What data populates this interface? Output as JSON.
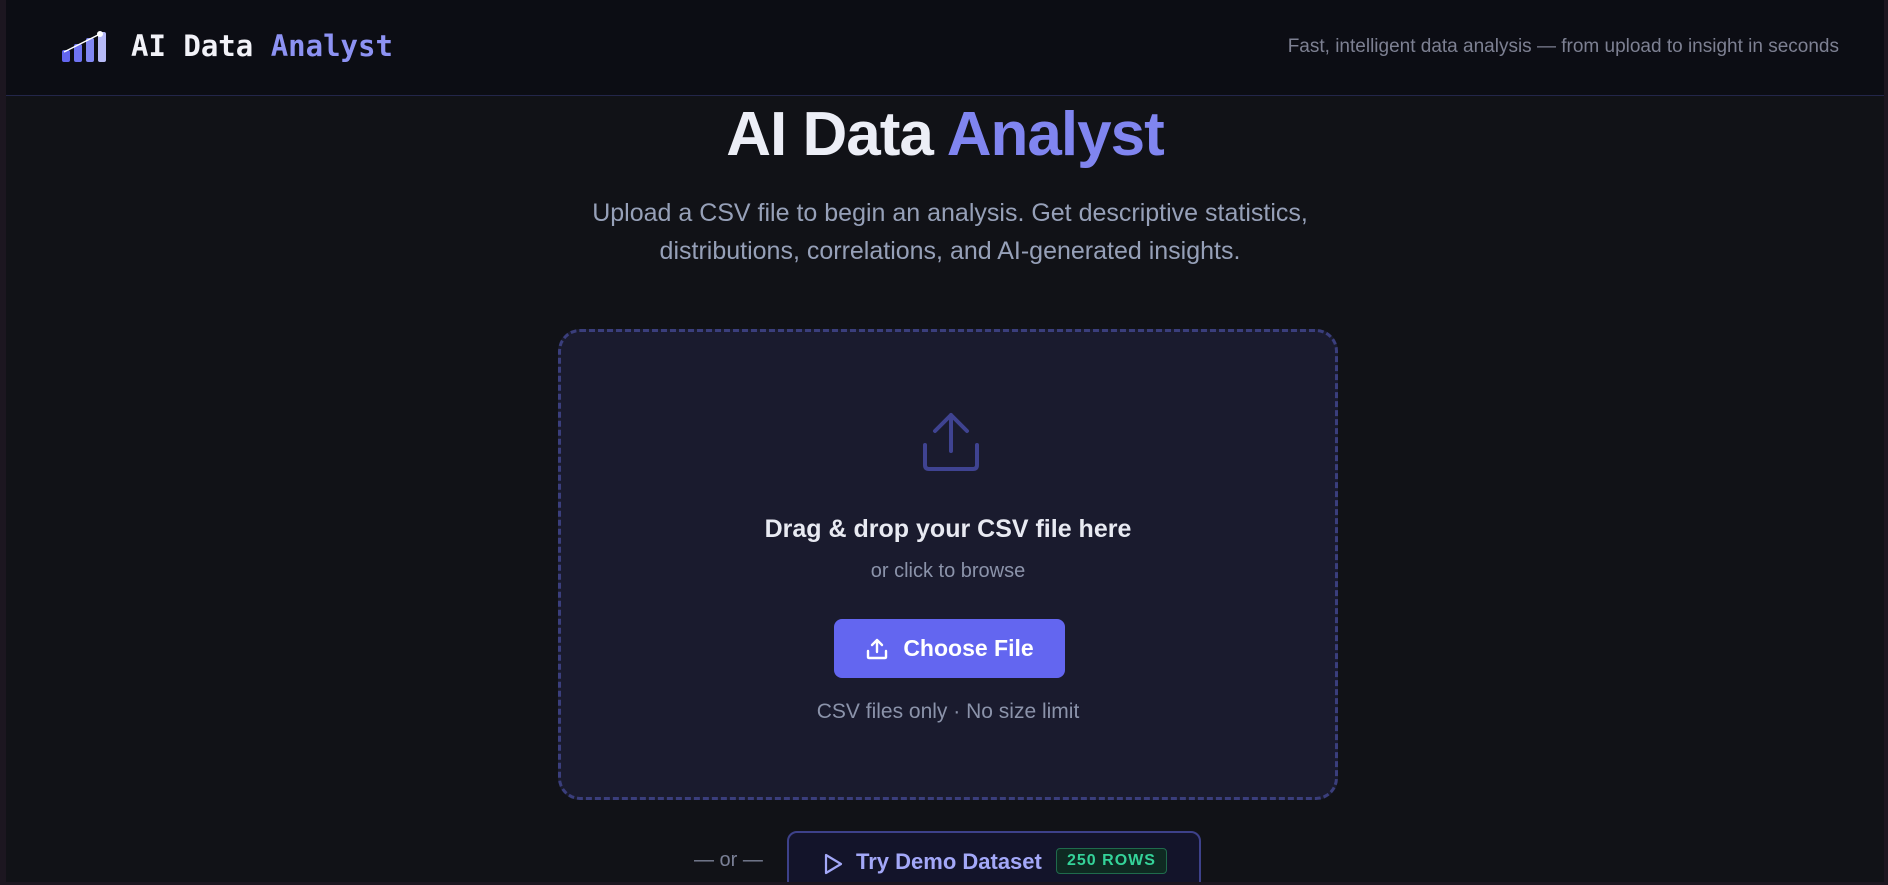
{
  "header": {
    "brand_main": "AI Data",
    "brand_accent": "Analyst",
    "tagline": "Fast, intelligent data analysis — from upload to insight in seconds",
    "logo_icon": "bar-chart-icon"
  },
  "hero": {
    "title_main": "AI Data",
    "title_accent": "Analyst",
    "subtitle": "Upload a CSV file to begin an analysis. Get descriptive statistics, distributions, correlations, and AI-generated insights."
  },
  "dropzone": {
    "icon": "upload-icon",
    "title": "Drag & drop your CSV file here",
    "subtitle": "or click to browse",
    "button_label": "Choose File",
    "note": "CSV files only · No size limit"
  },
  "demo": {
    "or_label": "— or —",
    "button_label": "Try Demo Dataset",
    "badge": "250 ROWS",
    "icon": "play-icon"
  },
  "colors": {
    "accent": "#6366f0",
    "accent_light": "#8d92f3",
    "background": "#111217",
    "badge_green": "#34d399"
  }
}
